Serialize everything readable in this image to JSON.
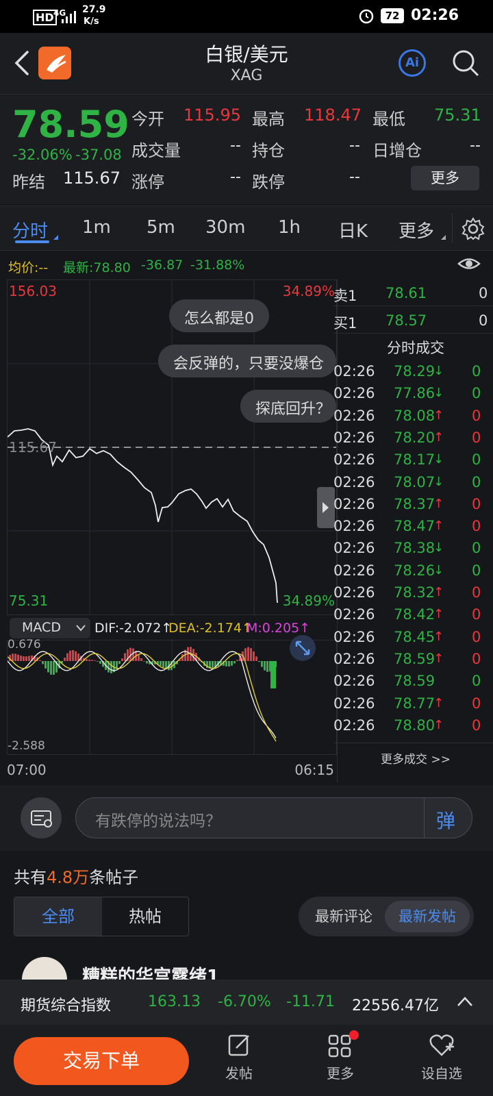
{
  "status": {
    "hd": "HD",
    "net": "4G",
    "speed": "27.9",
    "speed_unit": "K/s",
    "battery": "72",
    "time": "02:26"
  },
  "header": {
    "title": "白银/美元",
    "subtitle": "XAG",
    "ai_label": "Ai"
  },
  "quote": {
    "price": "78.59",
    "change_pct": "-32.06%",
    "change": "-37.08",
    "prev_close_label": "昨结",
    "prev_close": "115.67",
    "open_label": "今开",
    "open": "115.95",
    "high_label": "最高",
    "high": "118.47",
    "low_label": "最低",
    "low": "75.31",
    "volume_label": "成交量",
    "volume": "--",
    "position_label": "持仓",
    "position": "--",
    "daily_inc_label": "日增仓",
    "daily_inc": "--",
    "limit_up_label": "涨停",
    "limit_up": "--",
    "limit_down_label": "跌停",
    "limit_down": "--",
    "more_button": "更多"
  },
  "tabs": [
    "分时",
    "1m",
    "5m",
    "30m",
    "1h",
    "日K",
    "更多"
  ],
  "info": {
    "avg": "均价:--",
    "latest": "最新:78.80",
    "chg": "-36.87",
    "pct": "-31.88%"
  },
  "chart": {
    "top_price": "156.03",
    "top_pct": "34.89%",
    "bottom_price": "75.31",
    "bottom_pct": "34.89%",
    "ref_price": "115.67",
    "bubbles": [
      "怎么都是0",
      "会反弹的，只要没爆仓",
      "探底回升？"
    ]
  },
  "macd": {
    "selector": "MACD",
    "dif": "DIF:-2.072",
    "dea": "DEA:-2.174",
    "m": "M:0.205",
    "top": "0.676",
    "bottom": "-2.588"
  },
  "times": {
    "start": "07:00",
    "end": "06:15"
  },
  "orderbook": {
    "sell_label": "卖1",
    "sell_price": "78.61",
    "sell_qty": "0",
    "buy_label": "买1",
    "buy_price": "78.57",
    "buy_qty": "0",
    "ticks_title": "分时成交",
    "ticks": [
      {
        "time": "02:26",
        "price": "78.29",
        "dir": "down",
        "qty": "0"
      },
      {
        "time": "02:26",
        "price": "77.86",
        "dir": "down",
        "qty": "0"
      },
      {
        "time": "02:26",
        "price": "78.08",
        "dir": "up",
        "qty": "0"
      },
      {
        "time": "02:26",
        "price": "78.20",
        "dir": "up",
        "qty": "0"
      },
      {
        "time": "02:26",
        "price": "78.17",
        "dir": "down",
        "qty": "0"
      },
      {
        "time": "02:26",
        "price": "78.07",
        "dir": "down",
        "qty": "0"
      },
      {
        "time": "02:26",
        "price": "78.37",
        "dir": "up",
        "qty": "0"
      },
      {
        "time": "02:26",
        "price": "78.47",
        "dir": "up",
        "qty": "0"
      },
      {
        "time": "02:26",
        "price": "78.38",
        "dir": "down",
        "qty": "0"
      },
      {
        "time": "02:26",
        "price": "78.26",
        "dir": "down",
        "qty": "0"
      },
      {
        "time": "02:26",
        "price": "78.32",
        "dir": "up",
        "qty": "0"
      },
      {
        "time": "02:26",
        "price": "78.42",
        "dir": "up",
        "qty": "0"
      },
      {
        "time": "02:26",
        "price": "78.45",
        "dir": "up",
        "qty": "0"
      },
      {
        "time": "02:26",
        "price": "78.59",
        "dir": "up",
        "qty": "0"
      },
      {
        "time": "02:26",
        "price": "78.59",
        "dir": "none",
        "qty": "0"
      },
      {
        "time": "02:26",
        "price": "78.77",
        "dir": "up",
        "qty": "0"
      },
      {
        "time": "02:26",
        "price": "78.80",
        "dir": "up",
        "qty": "0"
      }
    ],
    "more_ticks": "更多成交 >>"
  },
  "input": {
    "placeholder": "有跌停的说法吗？",
    "danmu": "弹"
  },
  "posts": {
    "count_prefix": "共有",
    "count": "4.8万",
    "count_suffix": "条帖子",
    "tab_all": "全部",
    "tab_hot": "热帖",
    "sort_comment": "最新评论",
    "sort_post": "最新发帖",
    "first_user": "糟糕的华宫露绪1"
  },
  "ticker": {
    "name": "期货综合指数",
    "value": "163.13",
    "pct": "-6.70%",
    "chg": "-11.71",
    "amount": "22556.47亿"
  },
  "bottom": {
    "trade": "交易下单",
    "post": "发帖",
    "more": "更多",
    "watch": "设自选"
  }
}
